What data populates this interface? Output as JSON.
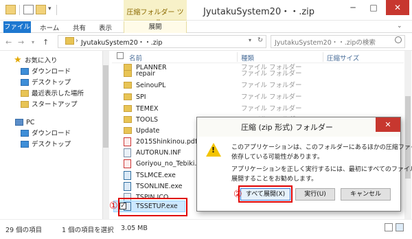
{
  "window": {
    "title": "JyutakuSystem20・・.zip",
    "context_tab_group": "圧縮フォルダー ツール",
    "minimize": "─",
    "maximize": "□",
    "close": "✕"
  },
  "ribbon": {
    "tabs": [
      "ファイル",
      "ホーム",
      "共有",
      "表示"
    ],
    "context_tab": "展開"
  },
  "address": {
    "path": "JyutakuSystem20・・.zip",
    "search_placeholder": "JyutakuSystem20・・.zipの検索",
    "back": "←",
    "forward": "→",
    "up": "↑"
  },
  "nav": {
    "favorites": "お気に入り",
    "fav_items": [
      "ダウンロード",
      "デスクトップ",
      "最近表示した場所",
      "スタートアップ"
    ],
    "pc": "PC",
    "pc_items": [
      "ダウンロード",
      "デスクトップ"
    ]
  },
  "columns": {
    "name": "名前",
    "type": "種類",
    "size": "圧縮サイズ"
  },
  "files": [
    {
      "name": "PLANNER",
      "type": "ファイル フォルダー",
      "kind": "folder"
    },
    {
      "name": "repair",
      "type": "ファイル フォルダー",
      "kind": "folder"
    },
    {
      "name": "SeinouPL",
      "type": "ファイル フォルダー",
      "kind": "folder"
    },
    {
      "name": "SPI",
      "type": "ファイル フォルダー",
      "kind": "folder"
    },
    {
      "name": "TEMEX",
      "type": "ファイル フォルダー",
      "kind": "folder"
    },
    {
      "name": "TOOLS",
      "type": "ファイル フォルダー",
      "kind": "folder"
    },
    {
      "name": "Update",
      "type": "ファイル フォルダー",
      "kind": "folder"
    },
    {
      "name": "2015Shinkinou.pdf",
      "type": "",
      "kind": "pdf"
    },
    {
      "name": "AUTORUN.INF",
      "type": "",
      "kind": "file"
    },
    {
      "name": "Goriyou_no_Tebiki...",
      "type": "",
      "kind": "pdf"
    },
    {
      "name": "TSLMCE.exe",
      "type": "",
      "kind": "exe"
    },
    {
      "name": "TSONLINE.exe",
      "type": "",
      "kind": "exe"
    },
    {
      "name": "TSPIN.ICO",
      "type": "",
      "kind": "file"
    },
    {
      "name": "TSSETUP.exe",
      "type": "",
      "kind": "exe"
    }
  ],
  "checkbox_mark": "✓",
  "annotations": {
    "mark1": "①",
    "mark2": "②"
  },
  "dialog": {
    "title": "圧縮 (zip 形式) フォルダー",
    "close": "✕",
    "warning_icon": "!",
    "message_lines": [
      "このアプリケーションは、このフォルダーにあるほかの圧縮ファイルに",
      "依存している可能性があります。",
      "アプリケーションを正しく実行するには、最初にすべてのファイルを",
      "展開することをお勧めします。"
    ],
    "buttons": {
      "extract_all": "すべて展開(X)",
      "run": "実行(U)",
      "cancel": "キャンセル"
    }
  },
  "status": {
    "item_count": "29 個の項目",
    "selection": "1 個の項目を選択",
    "size": "3.05 MB"
  }
}
